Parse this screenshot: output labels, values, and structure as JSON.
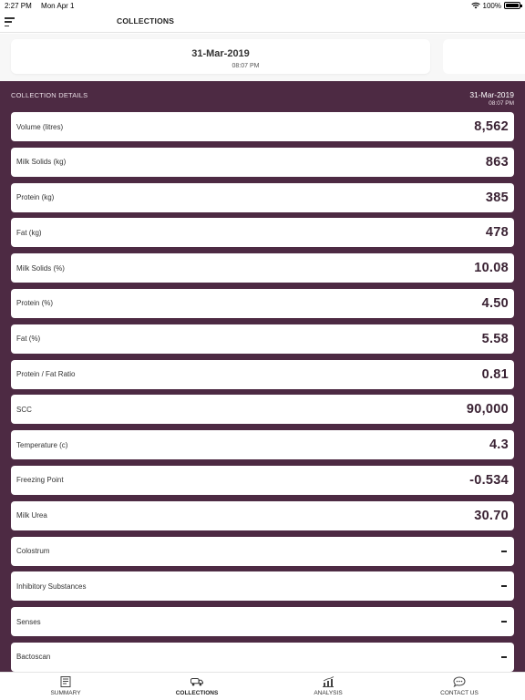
{
  "status_bar": {
    "time": "2:27 PM",
    "date": "Mon Apr 1",
    "battery": "100%"
  },
  "nav": {
    "title": "COLLECTIONS"
  },
  "date_card": {
    "date": "31-Mar-2019",
    "time": "08:07 PM"
  },
  "details": {
    "label": "COLLECTION DETAILS",
    "date": "31-Mar-2019",
    "time": "08:07 PM",
    "rows": [
      {
        "label": "Volume (litres)",
        "value": "8,562"
      },
      {
        "label": "Milk Solids (kg)",
        "value": "863"
      },
      {
        "label": "Protein (kg)",
        "value": "385"
      },
      {
        "label": "Fat (kg)",
        "value": "478"
      },
      {
        "label": "Milk Solids (%)",
        "value": "10.08"
      },
      {
        "label": "Protein (%)",
        "value": "4.50"
      },
      {
        "label": "Fat (%)",
        "value": "5.58"
      },
      {
        "label": "Protein / Fat Ratio",
        "value": "0.81"
      },
      {
        "label": "SCC",
        "value": "90,000"
      },
      {
        "label": "Temperature (c)",
        "value": "4.3"
      },
      {
        "label": "Freezing Point",
        "value": "-0.534"
      },
      {
        "label": "Milk Urea",
        "value": "30.70"
      },
      {
        "label": "Colostrum",
        "value": ""
      },
      {
        "label": "Inhibitory Substances",
        "value": ""
      },
      {
        "label": "Senses",
        "value": ""
      },
      {
        "label": "Bactoscan",
        "value": ""
      }
    ]
  },
  "tabs": [
    {
      "label": "SUMMARY",
      "icon": "summary-icon",
      "active": false
    },
    {
      "label": "COLLECTIONS",
      "icon": "truck-icon",
      "active": true
    },
    {
      "label": "ANALYSIS",
      "icon": "analysis-icon",
      "active": false
    },
    {
      "label": "CONTACT US",
      "icon": "chat-icon",
      "active": false
    }
  ],
  "colors": {
    "accent": "#4d2a43",
    "value_text": "#3a2233"
  }
}
